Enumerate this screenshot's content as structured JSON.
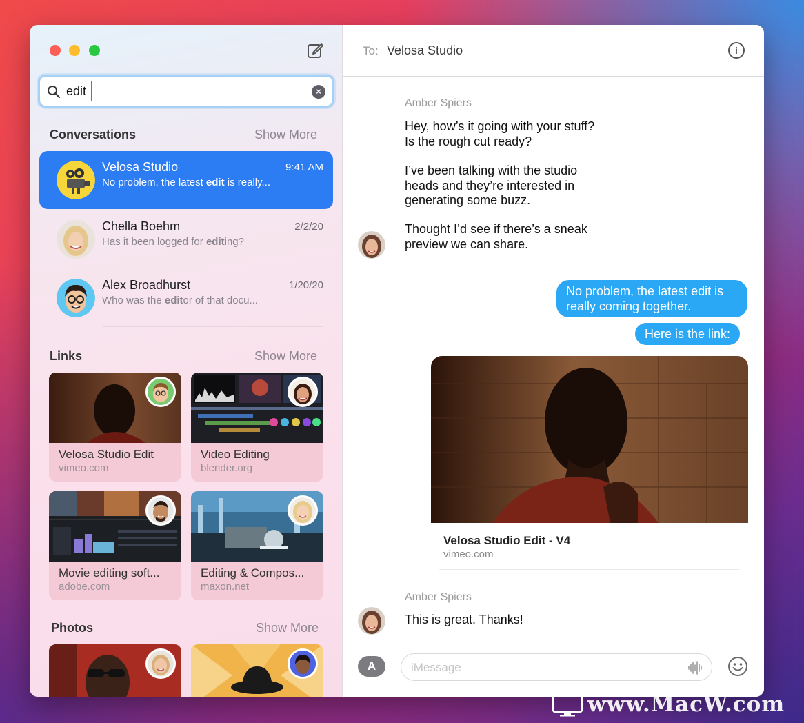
{
  "sidebar": {
    "search": {
      "query": "edit"
    },
    "conversations": {
      "title": "Conversations",
      "show_more": "Show More",
      "items": [
        {
          "name": "Velosa Studio",
          "time": "9:41 AM",
          "preview_pre": "No problem, the latest ",
          "preview_hl": "edit",
          "preview_post": " is really...",
          "selected": true
        },
        {
          "name": "Chella Boehm",
          "time": "2/2/20",
          "preview_pre": "Has it been logged for ",
          "preview_hl": "edit",
          "preview_post": "ing?",
          "selected": false
        },
        {
          "name": "Alex Broadhurst",
          "time": "1/20/20",
          "preview_pre": "Who was the ",
          "preview_hl": "edit",
          "preview_post": "or of that docu...",
          "selected": false
        }
      ]
    },
    "links": {
      "title": "Links",
      "show_more": "Show More",
      "items": [
        {
          "title": "Velosa Studio Edit",
          "domain": "vimeo.com"
        },
        {
          "title": "Video Editing",
          "domain": "blender.org"
        },
        {
          "title": "Movie editing soft...",
          "domain": "adobe.com"
        },
        {
          "title": "Editing & Compos...",
          "domain": "maxon.net"
        }
      ]
    },
    "photos": {
      "title": "Photos",
      "show_more": "Show More"
    }
  },
  "chat": {
    "to_label": "To:",
    "recipient": "Velosa Studio",
    "messages_in_1": {
      "sender": "Amber Spiers",
      "p1": "Hey, how’s it going with your stuff? Is the rough cut ready?",
      "p2": "I’ve been talking with the studio heads and they’re interested in generating some buzz.",
      "p3": "Thought I’d see if there’s a sneak preview we can share."
    },
    "out_1": "No problem, the latest edit is really coming together.",
    "out_2": "Here is the link:",
    "link_preview": {
      "title": "Velosa Studio Edit - V4",
      "domain": "vimeo.com"
    },
    "messages_in_2": {
      "sender": "Amber Spiers",
      "text": "This is great. Thanks!"
    },
    "input_placeholder": "iMessage"
  },
  "watermark": {
    "text": "www.MacW.com"
  },
  "colors": {
    "accent": "#2c7df4",
    "outgoing_bubble": "#2aa7f5"
  }
}
